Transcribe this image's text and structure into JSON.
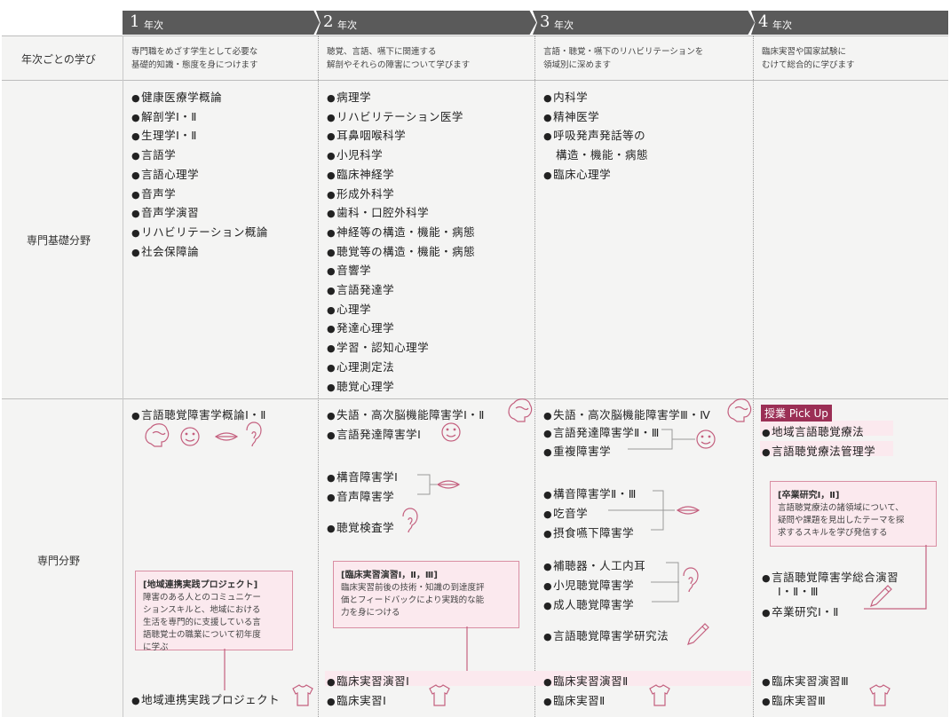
{
  "headers": [
    {
      "num": "1",
      "label": "年次"
    },
    {
      "num": "2",
      "label": "年次"
    },
    {
      "num": "3",
      "label": "年次"
    },
    {
      "num": "4",
      "label": "年次"
    }
  ],
  "rows": {
    "learning": "年次ごとの学び",
    "basic": "専門基礎分野",
    "specialized": "専門分野"
  },
  "desc": {
    "y1a": "専門職をめざす学生として必要な",
    "y1b": "基礎的知識・態度を身につけます",
    "y2a": "聴覚、言語、嚥下に関連する",
    "y2b": "解剖やそれらの障害について学びます",
    "y3a": "言語・聴覚・嚥下のリハビリテーションを",
    "y3b": "領域別に深めます",
    "y4a": "臨床実習や国家試験に",
    "y4b": "むけて総合的に学びます"
  },
  "basic": {
    "y1": [
      "健康医療学概論",
      "解剖学Ⅰ・Ⅱ",
      "生理学Ⅰ・Ⅱ",
      "言語学",
      "言語心理学",
      "音声学",
      "音声学演習",
      "リハビリテーション概論",
      "社会保障論"
    ],
    "y2": [
      "病理学",
      "リハビリテーション医学",
      "耳鼻咽喉科学",
      "小児科学",
      "臨床神経学",
      "形成外科学",
      "歯科・口腔外科学",
      "神経等の構造・機能・病態",
      "聴覚等の構造・機能・病態",
      "音響学",
      "言語発達学",
      "心理学",
      "発達心理学",
      "学習・認知心理学",
      "心理測定法",
      "聴覚心理学"
    ],
    "y3": [
      "内科学",
      "精神医学",
      "呼吸発声発話等の",
      "構造・機能・病態",
      "臨床心理学"
    ]
  },
  "spec": {
    "y1": {
      "i1": "言語聴覚障害学概論Ⅰ・Ⅱ",
      "i2": "地域連携実践プロジェクト",
      "box_title": "[地域連携実践プロジェクト]",
      "box_body": [
        "障害のある人とのコミュニケー",
        "ションスキルと、地域における",
        "生活を専門的に支援している言",
        "語聴覚士の職業について初年度",
        "に学ぶ"
      ]
    },
    "y2": {
      "i1": "失語・高次脳機能障害学Ⅰ・Ⅱ",
      "i2": "言語発達障害学Ⅰ",
      "i3": "構音障害学Ⅰ",
      "i4": "音声障害学",
      "i5": "聴覚検査学",
      "i6": "臨床実習演習Ⅰ",
      "i7": "臨床実習Ⅰ",
      "box_title": "[臨床実習演習Ⅰ，Ⅱ，Ⅲ]",
      "box_body": [
        "臨床実習前後の技術・知識の到達度評",
        "価とフィードバックにより実践的な能",
        "力を身につける"
      ]
    },
    "y3": {
      "i1": "失語・高次脳機能障害学Ⅲ・Ⅳ",
      "i2": "言語発達障害学Ⅱ・Ⅲ",
      "i3": "重複障害学",
      "i4": "構音障害学Ⅱ・Ⅲ",
      "i5": "吃音学",
      "i6": "摂食嚥下障害学",
      "i7": "補聴器・人工内耳",
      "i8": "小児聴覚障害学",
      "i9": "成人聴覚障害学",
      "i10": "言語聴覚障害学研究法",
      "i11": "臨床実習演習Ⅱ",
      "i12": "臨床実習Ⅱ"
    },
    "y4": {
      "pickup": "授業 Pick Up",
      "i1": "地域言語聴覚療法",
      "i2": "言語聴覚療法管理学",
      "i3": "言語聴覚障害学総合演習",
      "i3b": "Ⅰ・Ⅱ・Ⅲ",
      "i4": "卒業研究Ⅰ・Ⅱ",
      "i5": "臨床実習演習Ⅲ",
      "i6": "臨床実習Ⅲ",
      "box_title": "[卒業研究Ⅰ，Ⅱ]",
      "box_body": [
        "言語聴覚療法の諸領域について、",
        "疑問や課題を見出したテーマを探",
        "求するスキルを学び発信する"
      ]
    }
  }
}
